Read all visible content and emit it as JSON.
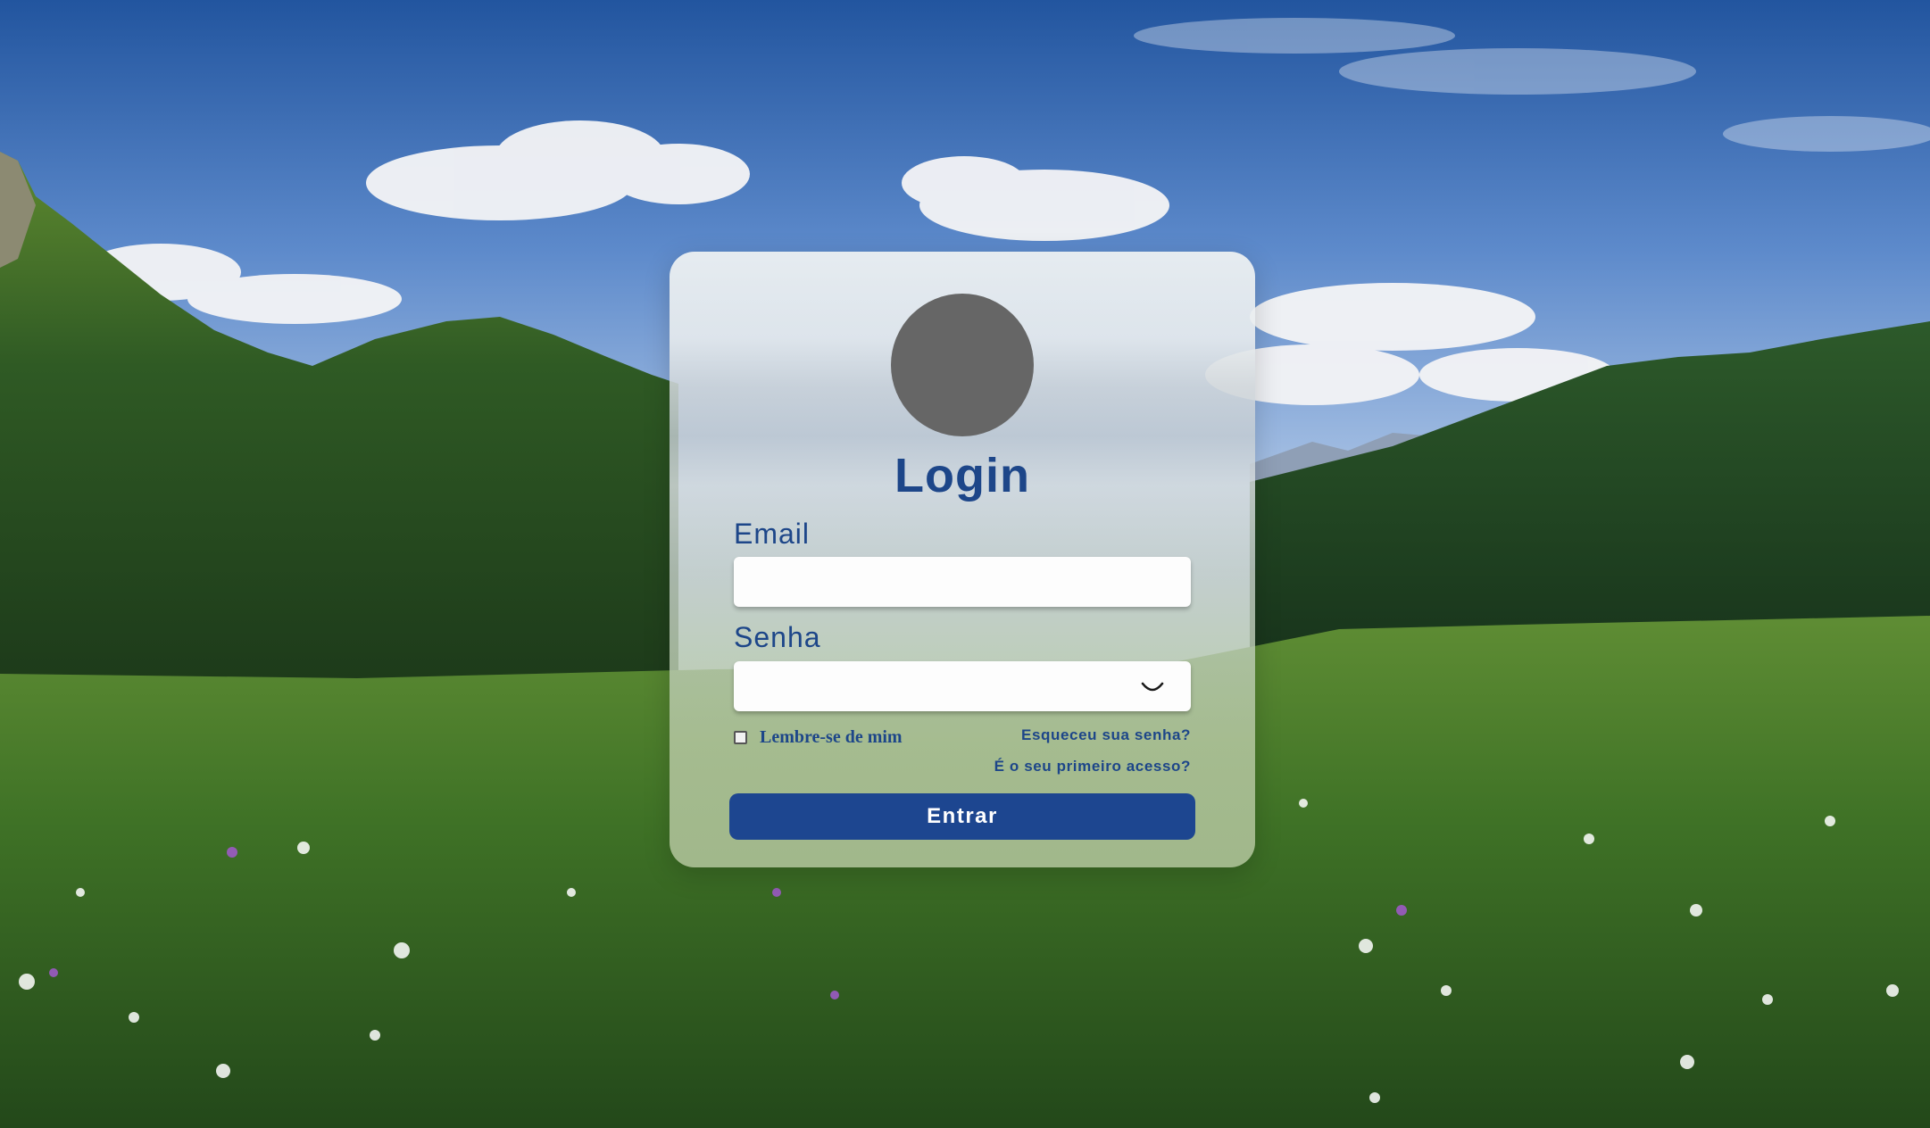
{
  "background": {
    "scene": "mountain meadow landscape with blue sky and clouds",
    "sky_color": "#2c5fae",
    "grass_color": "#3f6b25"
  },
  "login": {
    "title": "Login",
    "avatar_color": "#666666",
    "email": {
      "label": "Email",
      "value": "",
      "placeholder": ""
    },
    "password": {
      "label": "Senha",
      "value": "",
      "placeholder": "",
      "toggle_icon": "eye-closed-icon"
    },
    "remember": {
      "label": "Lembre-se de mim",
      "checked": false
    },
    "forgot_link": "Esqueceu sua senha?",
    "first_access_link": "É o seu primeiro acesso?",
    "submit_label": "Entrar",
    "accent_color": "#1d4689"
  }
}
